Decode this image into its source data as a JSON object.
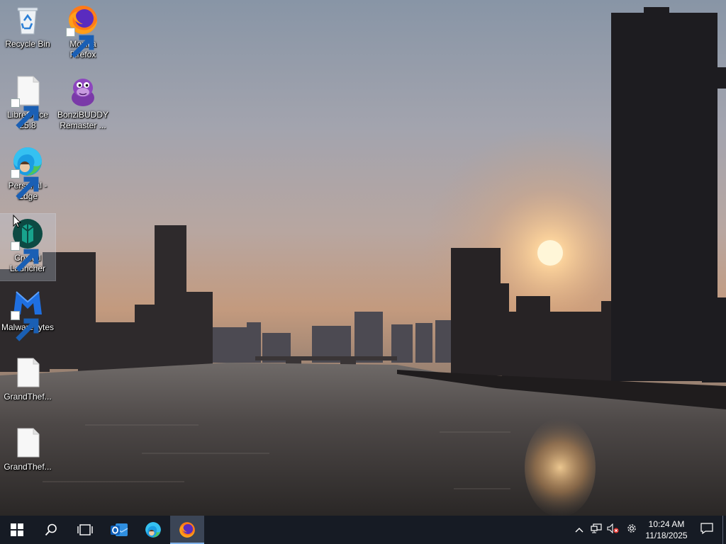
{
  "desktop": {
    "icons": [
      {
        "label": "Recycle Bin"
      },
      {
        "label": "Mozilla Firefox"
      },
      {
        "label": "LibreOffice 25.8"
      },
      {
        "label": "BonziBUDDY Remaster ..."
      },
      {
        "label": "Personal - Edge"
      },
      {
        "label": "Crystal Launcher"
      },
      {
        "label": "Malwarebytes"
      },
      {
        "label": "GrandThef..."
      },
      {
        "label": "GrandThef..."
      }
    ]
  },
  "taskbar": {
    "start_icon": "windows-logo-icon",
    "search_icon": "search-icon",
    "task_view_icon": "task-view-icon",
    "pinned": [
      "outlook-icon",
      "edge-icon",
      "firefox-icon"
    ],
    "tray": {
      "overflow_icon": "chevron-up-icon",
      "network_icon": "network-icon",
      "volume_icon": "volume-muted-icon",
      "settings_icon": "gear-icon",
      "time": "10:24 AM",
      "date": "11/18/2025",
      "notification_icon": "notification-icon"
    }
  },
  "colors": {
    "taskbar_bg": "#161b24",
    "active_indicator": "#7fb0e8"
  }
}
